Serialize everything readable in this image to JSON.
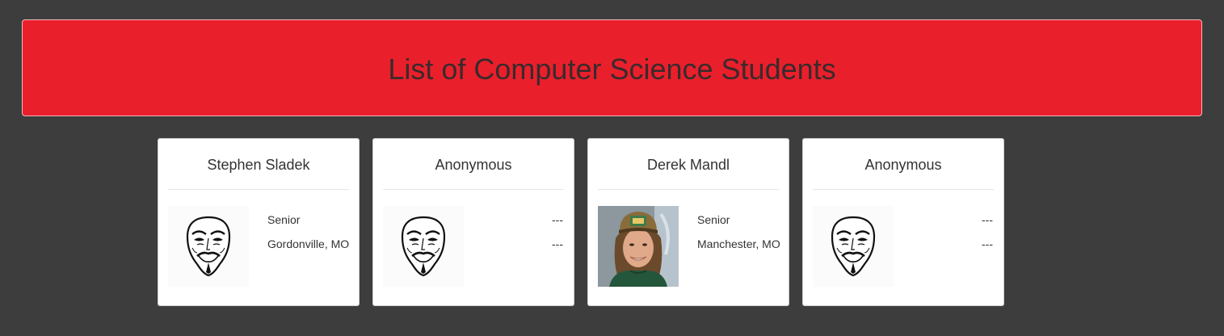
{
  "header": {
    "title": "List of Computer Science Students"
  },
  "students": [
    {
      "name": "Stephen Sladek",
      "photo": "anonymous-mask",
      "class_year": "Senior",
      "hometown": "Gordonville, MO"
    },
    {
      "name": "Anonymous",
      "photo": "anonymous-mask",
      "class_year": "---",
      "hometown": "---"
    },
    {
      "name": "Derek Mandl",
      "photo": "student-portrait",
      "class_year": "Senior",
      "hometown": "Manchester, MO"
    },
    {
      "name": "Anonymous",
      "photo": "anonymous-mask",
      "class_year": "---",
      "hometown": "---"
    }
  ]
}
